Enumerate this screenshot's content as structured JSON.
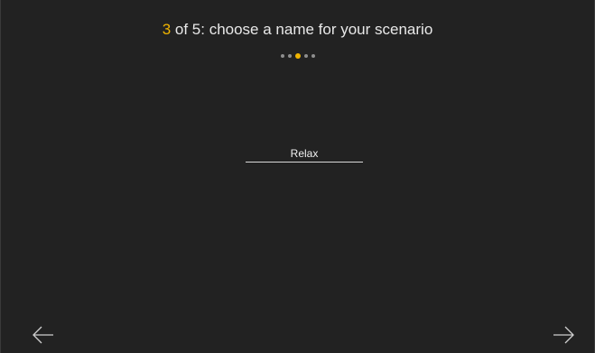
{
  "header": {
    "step_current": "3",
    "step_rest": " of 5: choose a name for your scenario"
  },
  "progress": {
    "total_steps": 5,
    "current_step": 3,
    "active_color": "#f0b400",
    "inactive_color": "#8e8e8e"
  },
  "name_input": {
    "value": "Relax",
    "placeholder": ""
  },
  "navigation": {
    "back_icon": "arrow-left-icon",
    "next_icon": "arrow-right-icon"
  },
  "colors": {
    "background": "#222222",
    "accent": "#f0b400",
    "text": "#e8e8e8"
  }
}
